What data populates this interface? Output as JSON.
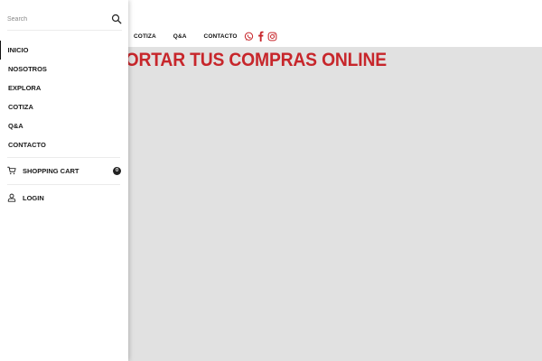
{
  "header": {
    "nav": [
      "COTIZA",
      "Q&A",
      "CONTACTO"
    ],
    "social_icons": [
      "whatsapp-icon",
      "facebook-icon",
      "instagram-icon"
    ]
  },
  "hero": {
    "title": "ON PARA IMPORTAR TUS COMPRAS ONLINE"
  },
  "drawer": {
    "search": {
      "placeholder": "Search",
      "value": "",
      "icon": "search-icon"
    },
    "menu": [
      "INICIO",
      "NOSOTROS",
      "EXPLORA",
      "COTIZA",
      "Q&A",
      "CONTACTO"
    ],
    "active_item": "INICIO",
    "cart": {
      "label": "SHOPPING CART",
      "count": "0",
      "icon": "cart-icon"
    },
    "login": {
      "label": "LOGIN",
      "icon": "user-icon"
    }
  },
  "colors": {
    "accent_red": "#c7262b",
    "hero_background": "#e1e1e1",
    "text_dark": "#1a1a1a"
  }
}
